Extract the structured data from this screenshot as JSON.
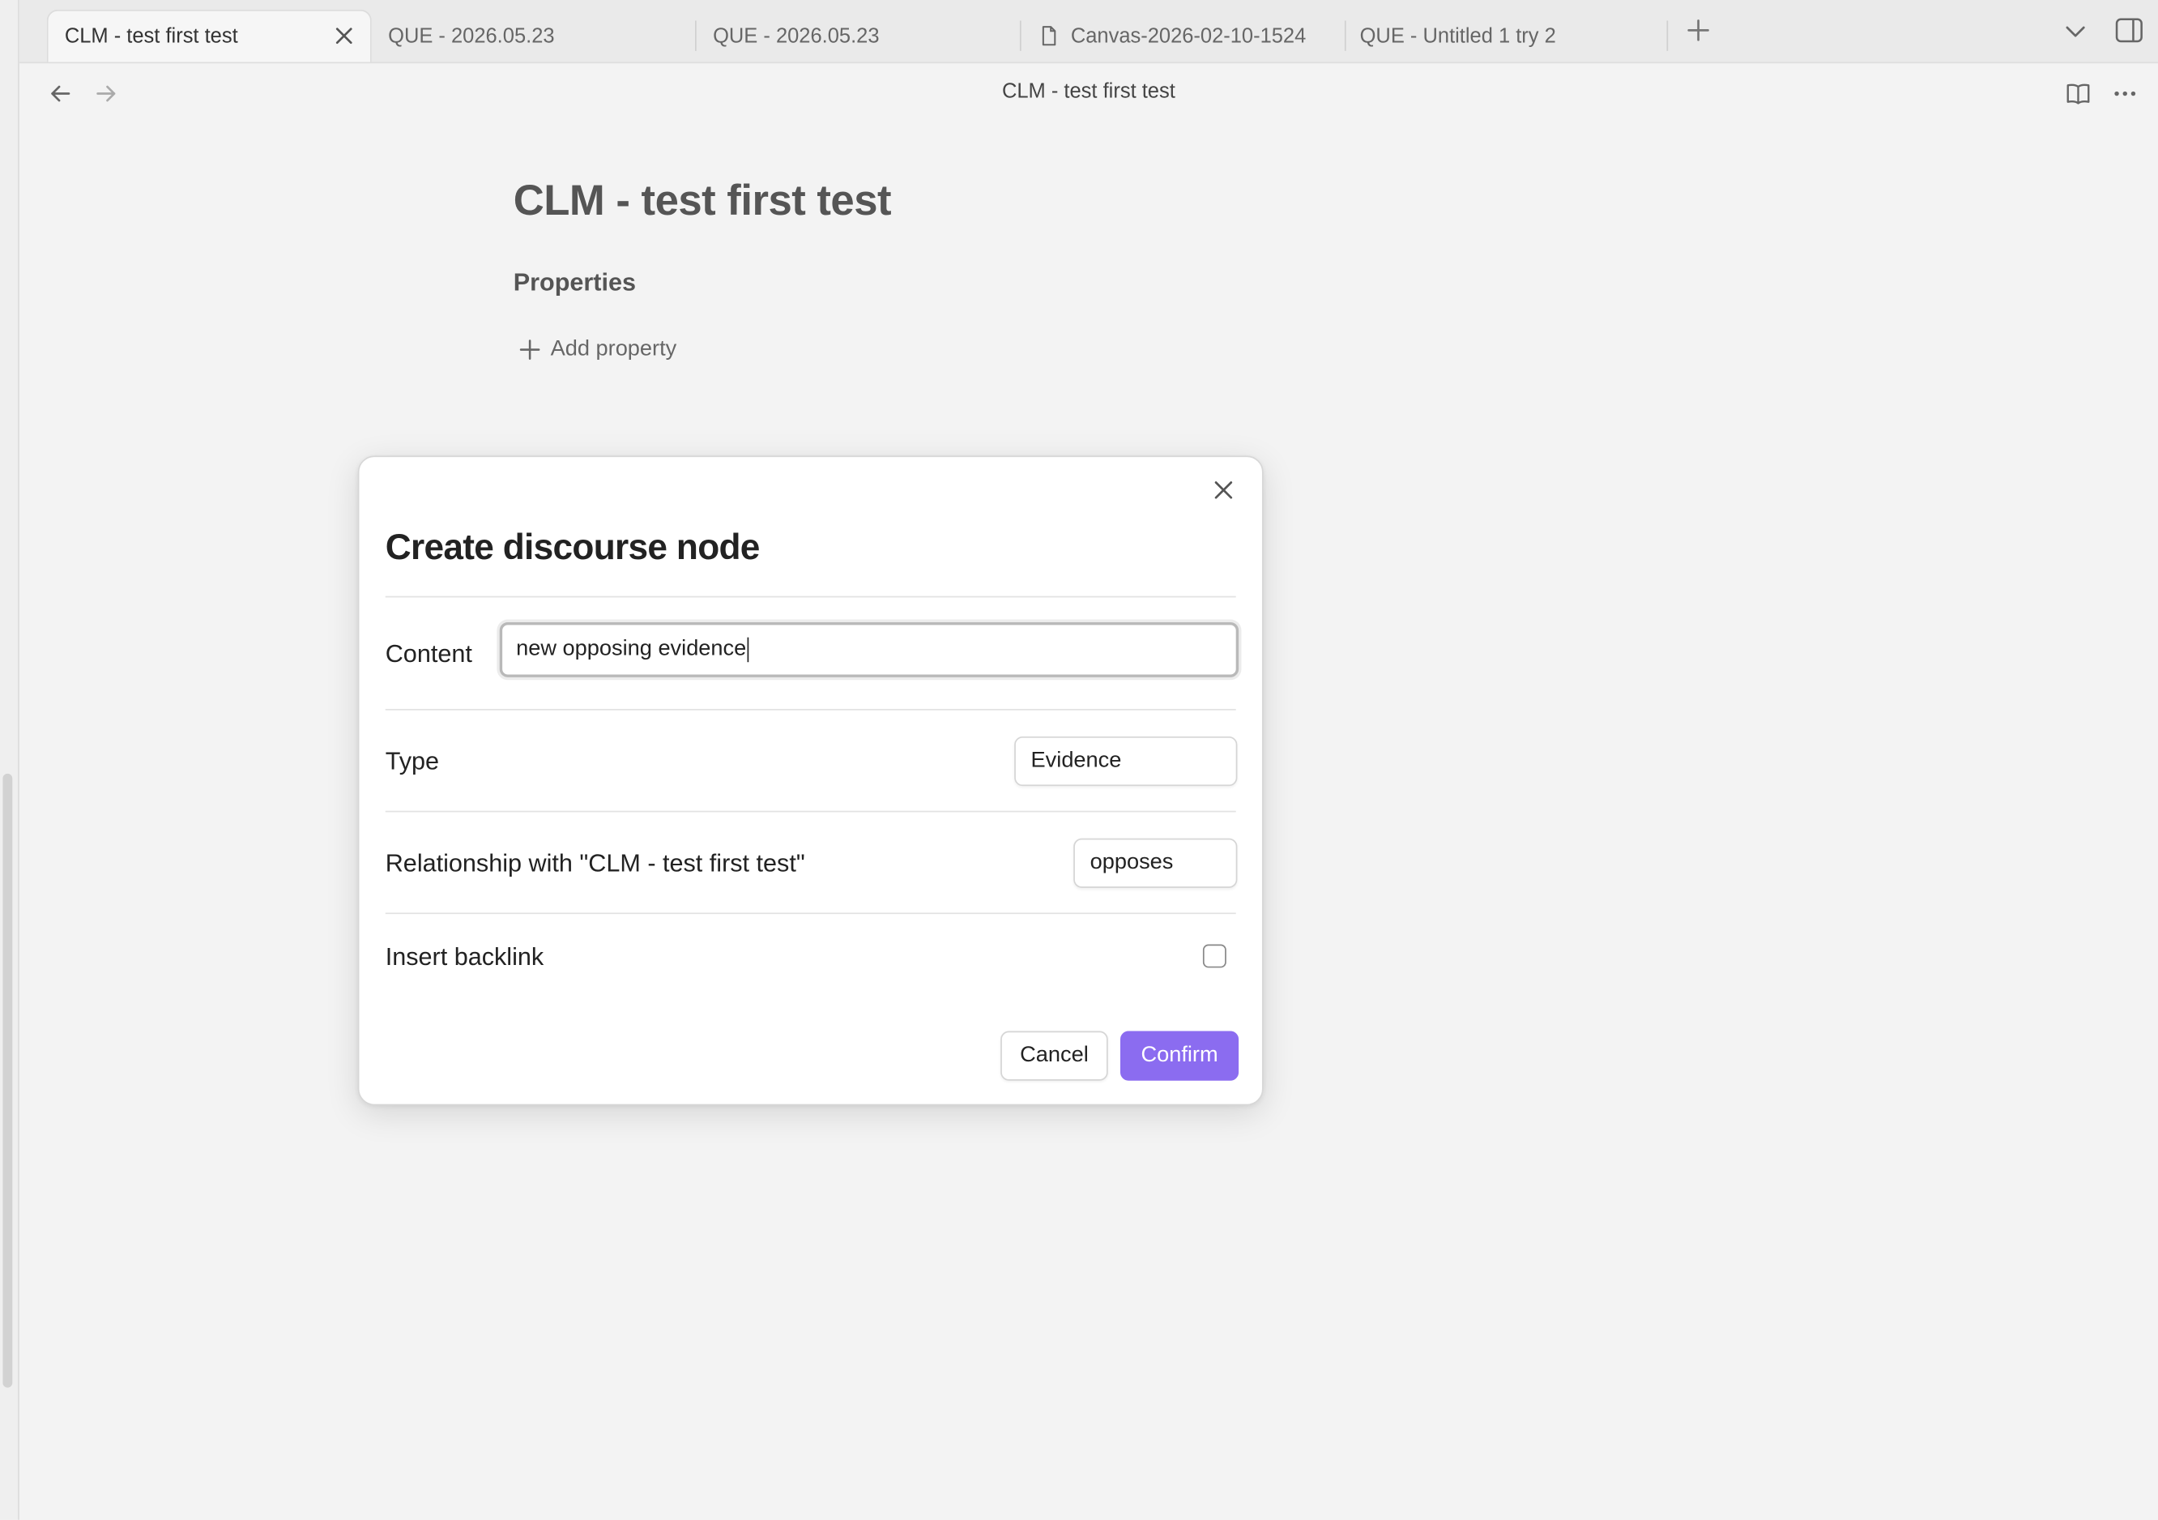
{
  "tabs": [
    {
      "label": "CLM - test first test",
      "active": true
    },
    {
      "label": "QUE - 2026.05.23",
      "active": false
    },
    {
      "label": "QUE - 2026.05.23",
      "active": false
    },
    {
      "label": "Canvas-2026-02-10-1524",
      "active": false,
      "icon": "file-icon"
    },
    {
      "label": "QUE - Untitled 1 try 2",
      "active": false
    }
  ],
  "nav": {
    "title": "CLM - test first test"
  },
  "note": {
    "title": "CLM - test first test",
    "properties_heading": "Properties",
    "add_property_label": "Add property"
  },
  "modal": {
    "title": "Create discourse node",
    "content_label": "Content",
    "content_value": "new opposing evidence",
    "type_label": "Type",
    "type_value": "Evidence",
    "relationship_label": "Relationship with \"CLM - test first test\"",
    "relationship_value": "opposes",
    "backlink_label": "Insert backlink",
    "backlink_checked": false,
    "cancel_label": "Cancel",
    "confirm_label": "Confirm"
  },
  "colors": {
    "accent": "#8b6cf0",
    "background": "#f3f3f3",
    "link": "#8b73e8"
  }
}
